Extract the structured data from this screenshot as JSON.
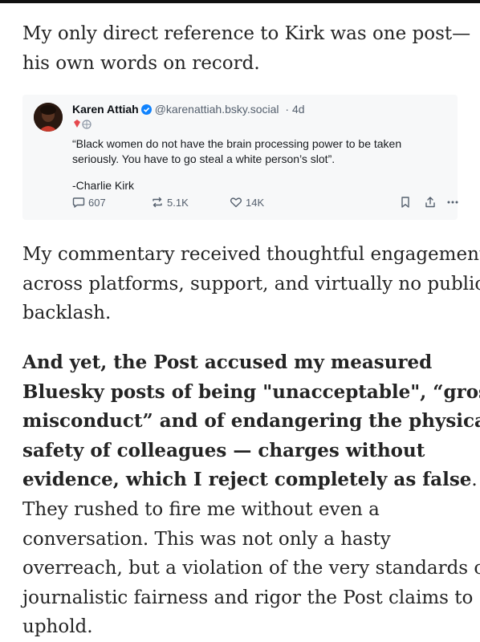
{
  "article": {
    "para1": [
      "My only direct reference to Kirk was one post—",
      "his own words on record."
    ],
    "embed": {
      "author_name": "Karen Attiah",
      "handle": "@karenattiah.bsky.social",
      "time": "· 4d",
      "quote_lines": [
        "“Black women do not have the brain processing power to be taken",
        "seriously. You have to go steal a white person’s slot”."
      ],
      "signature": "-Charlie Kirk",
      "replies": "607",
      "reposts": "5.1K",
      "likes": "14K",
      "icons": {
        "verified": "verified-check-icon",
        "reply": "speech-bubble-icon",
        "repost": "repost-arrows-icon",
        "like": "heart-icon",
        "bookmark": "bookmark-icon",
        "share": "share-icon",
        "more": "ellipsis-icon"
      },
      "colors": {
        "verified": "#1083fe",
        "badge_red": "#e5484d",
        "muted": "#55606e"
      }
    },
    "para2": [
      "My commentary received thoughtful engagement",
      "across platforms, support, and virtually no public",
      "backlash."
    ],
    "para3_bold": [
      "And yet, the Post accused my measured",
      "Bluesky posts of being \"unacceptable\", “gross",
      "misconduct” and of endangering the physical",
      "safety of colleagues — charges without",
      "evidence, which I reject completely as false"
    ],
    "para3_bold_end": ".",
    "para3_regular": [
      "They rushed to fire me without even a",
      "conversation. This was not only a hasty",
      "overreach, but a violation of the very standards of",
      "journalistic fairness and rigor the Post claims to",
      "uphold."
    ]
  }
}
